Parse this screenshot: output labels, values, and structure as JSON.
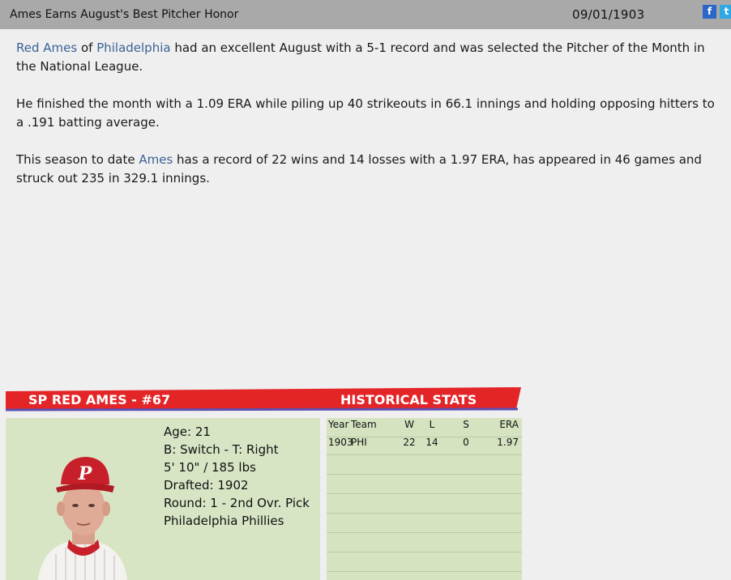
{
  "news": {
    "headline": "Ames Earns August's Best Pitcher Honor",
    "date": "09/01/1903",
    "facebook_label": "f",
    "twitter_label": "t",
    "p1_link1": "Red Ames",
    "p1_text1": " of ",
    "p1_link2": "Philadelphia",
    "p1_text2": " had an excellent August with a 5-1 record and was selected the Pitcher of the Month in the National League.",
    "p2": "He finished the month with a 1.09 ERA while piling up 40 strikeouts in 66.1 innings and holding opposing hitters to a .191 batting average.",
    "p3_text1": "This season to date ",
    "p3_link": "Ames",
    "p3_text2": " has a record of 22 wins and 14 losses with a 1.97 ERA, has appeared in 46 games and struck out 235 in 329.1 innings."
  },
  "player": {
    "name": "SP RED AMES - #67",
    "age": "Age: 21",
    "bats_throws": "B: Switch - T: Right",
    "height_weight": "5' 10\" / 185 lbs",
    "drafted": "Drafted: 1902",
    "round": "Round: 1 - 2nd Ovr. Pick",
    "team": "Philadelphia Phillies",
    "cap_letter": "P",
    "colors": {
      "cap": "#c8202a",
      "header": "#e32528"
    }
  },
  "historical": {
    "title": "HISTORICAL STATS",
    "columns": {
      "year": "Year",
      "team": "Team",
      "w": "W",
      "l": "L",
      "s": "S",
      "era": "ERA"
    },
    "rows": [
      {
        "year": "1903",
        "team": "PHI",
        "w": "22",
        "l": "14",
        "s": "0",
        "era": "1.97"
      }
    ]
  }
}
